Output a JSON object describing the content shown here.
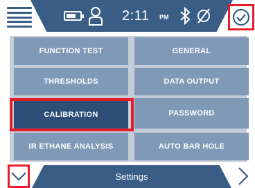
{
  "colors": {
    "primary": "#3a5d86",
    "cell": "#7f99b6",
    "cell_selected": "#2e4e78",
    "highlight": "#e61e28",
    "grid_bg": "#c3ccd7"
  },
  "status": {
    "time": "2:11",
    "ampm": "PM",
    "battery_level_fraction": 0.6,
    "icons": [
      "menu-icon",
      "battery-icon",
      "user-icon",
      "bluetooth-icon",
      "no-signal-icon",
      "checkmark-icon"
    ]
  },
  "menu": {
    "items": [
      {
        "label": "FUNCTION TEST"
      },
      {
        "label": "GENERAL"
      },
      {
        "label": "THRESHOLDS"
      },
      {
        "label": "DATA OUTPUT"
      },
      {
        "label": "CALIBRATION",
        "selected": true
      },
      {
        "label": "PASSWORD"
      },
      {
        "label": "IR ETHANE ANALYSIS"
      },
      {
        "label": "AUTO BAR HOLE"
      }
    ]
  },
  "footer": {
    "title": "Settings",
    "icons": [
      "chevron-down-icon",
      "chevron-right-icon"
    ]
  }
}
